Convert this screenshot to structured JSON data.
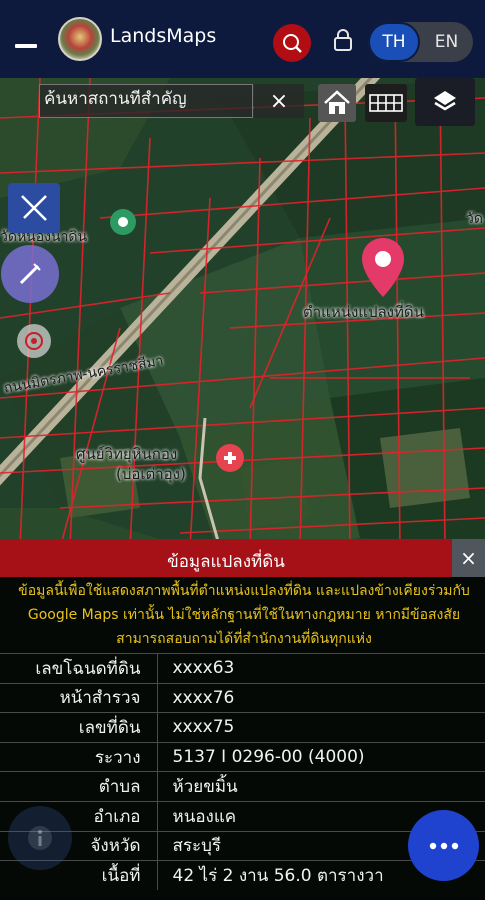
{
  "header": {
    "brand": "LandsMaps",
    "lang_th": "TH",
    "lang_en": "EN"
  },
  "map": {
    "search_placeholder": "ค้นหาสถานที่สำคัญ",
    "clear_label": "×",
    "labels": {
      "parcel_label": "ตำแหน่งแปลงที่ดิน",
      "road_label": "ถนนมิตรภาพ-นครราชสีมา",
      "school_label": "ศูนย์วิทยุหินกอง",
      "school_sub": "(บ่อเต่าอุง)",
      "place_left": "วัดหนองนาดิน",
      "edge_right": "วัด"
    }
  },
  "panel": {
    "title": "ข้อมูลแปลงที่ดิน",
    "close_label": "×",
    "disclaimer": "ข้อมูลนี้เพื่อใช้แสดงสภาพพื้นที่ตำแหน่งแปลงที่ดิน และแปลงข้างเคียงร่วมกับ Google Maps เท่านั้น ไม่ใช่หลักฐานที่ใช้ในทางกฎหมาย หากมีข้อสงสัยสามารถสอบถามได้ที่สำนักงานที่ดินทุกแห่ง",
    "rows": [
      {
        "key": "เลขโฉนดที่ดิน",
        "value": "xxxx63"
      },
      {
        "key": "หน้าสำรวจ",
        "value": "xxxx76"
      },
      {
        "key": "เลขที่ดิน",
        "value": "xxxx75"
      },
      {
        "key": "ระวาง",
        "value": "5137 I 0296-00 (4000)"
      },
      {
        "key": "ตำบล",
        "value": "ห้วยขมิ้น"
      },
      {
        "key": "อำเภอ",
        "value": "หนองแค"
      },
      {
        "key": "จังหวัด",
        "value": "สระบุรี"
      },
      {
        "key": "เนื้อที่",
        "value": "42 ไร่ 2 งาน 56.0 ตารางวา"
      }
    ]
  },
  "colors": {
    "header_bg": "#0d1a3e",
    "panel_red": "#a61017",
    "accent_blue": "#1f42cf",
    "disclaimer_yellow": "#e8c21c",
    "parcel_line": "#e3232b"
  }
}
